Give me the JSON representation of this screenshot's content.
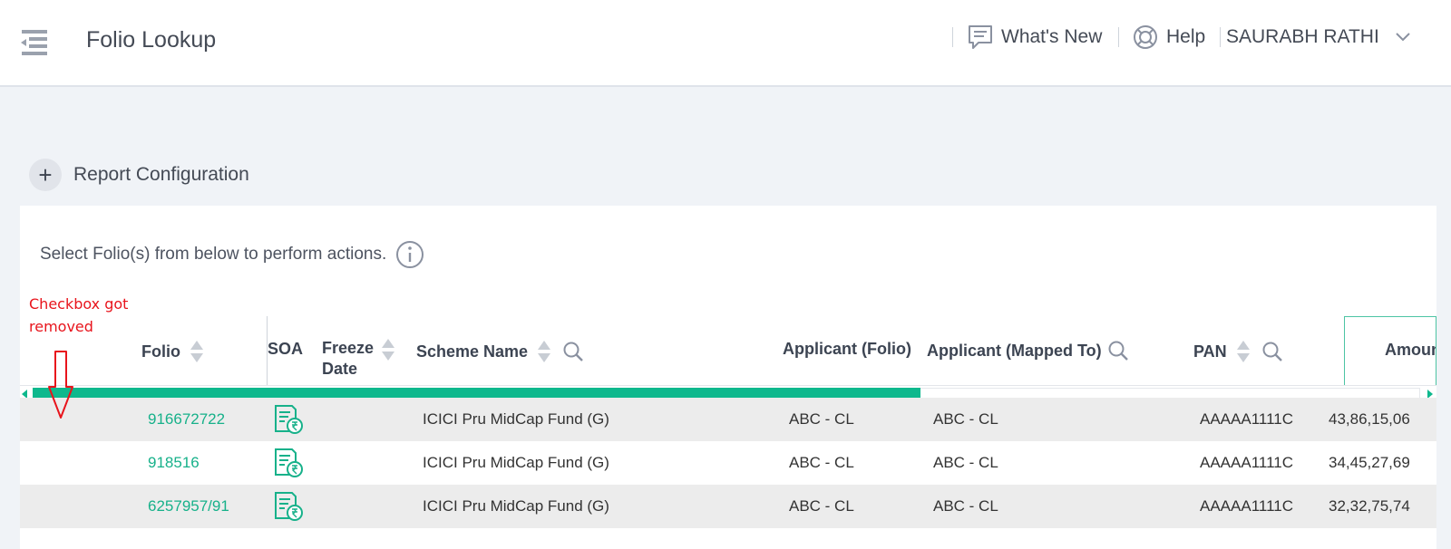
{
  "header": {
    "title": "Folio Lookup",
    "whats_new": "What's New",
    "help": "Help",
    "user_name": "SAURABH RATHI"
  },
  "report_config": {
    "plus": "+",
    "label": "Report Configuration"
  },
  "instruction": "Select Folio(s) from below to perform actions.",
  "annotation": {
    "line1": "Checkbox got",
    "line2": "removed"
  },
  "table": {
    "columns": {
      "folio": "Folio",
      "soa": "SOA",
      "freeze_date_1": "Freeze",
      "freeze_date_2": "Date",
      "scheme_name": "Scheme Name",
      "applicant_folio": "Applicant (Folio)",
      "applicant_mapped": "Applicant (Mapped To)",
      "pan": "PAN",
      "amount": "Amount"
    },
    "scroll_position": 0.64,
    "rows": [
      {
        "folio": "916672722",
        "scheme": "ICICI Pru MidCap Fund (G)",
        "applicant_folio": "ABC - CL",
        "applicant_mapped": "ABC - CL",
        "pan": "AAAAA1111C",
        "amount": "43,86,15,06"
      },
      {
        "folio": "918516",
        "scheme": "ICICI Pru MidCap Fund (G)",
        "applicant_folio": "ABC - CL",
        "applicant_mapped": "ABC - CL",
        "pan": "AAAAA1111C",
        "amount": "34,45,27,69"
      },
      {
        "folio": "6257957/91",
        "scheme": "ICICI Pru MidCap Fund (G)",
        "applicant_folio": "ABC - CL",
        "applicant_mapped": "ABC - CL",
        "pan": "AAAAA1111C",
        "amount": "32,32,75,74"
      }
    ]
  },
  "colors": {
    "accent": "#17b18a",
    "scrollbar": "#0eb88d",
    "annotation": "#e8141c"
  }
}
